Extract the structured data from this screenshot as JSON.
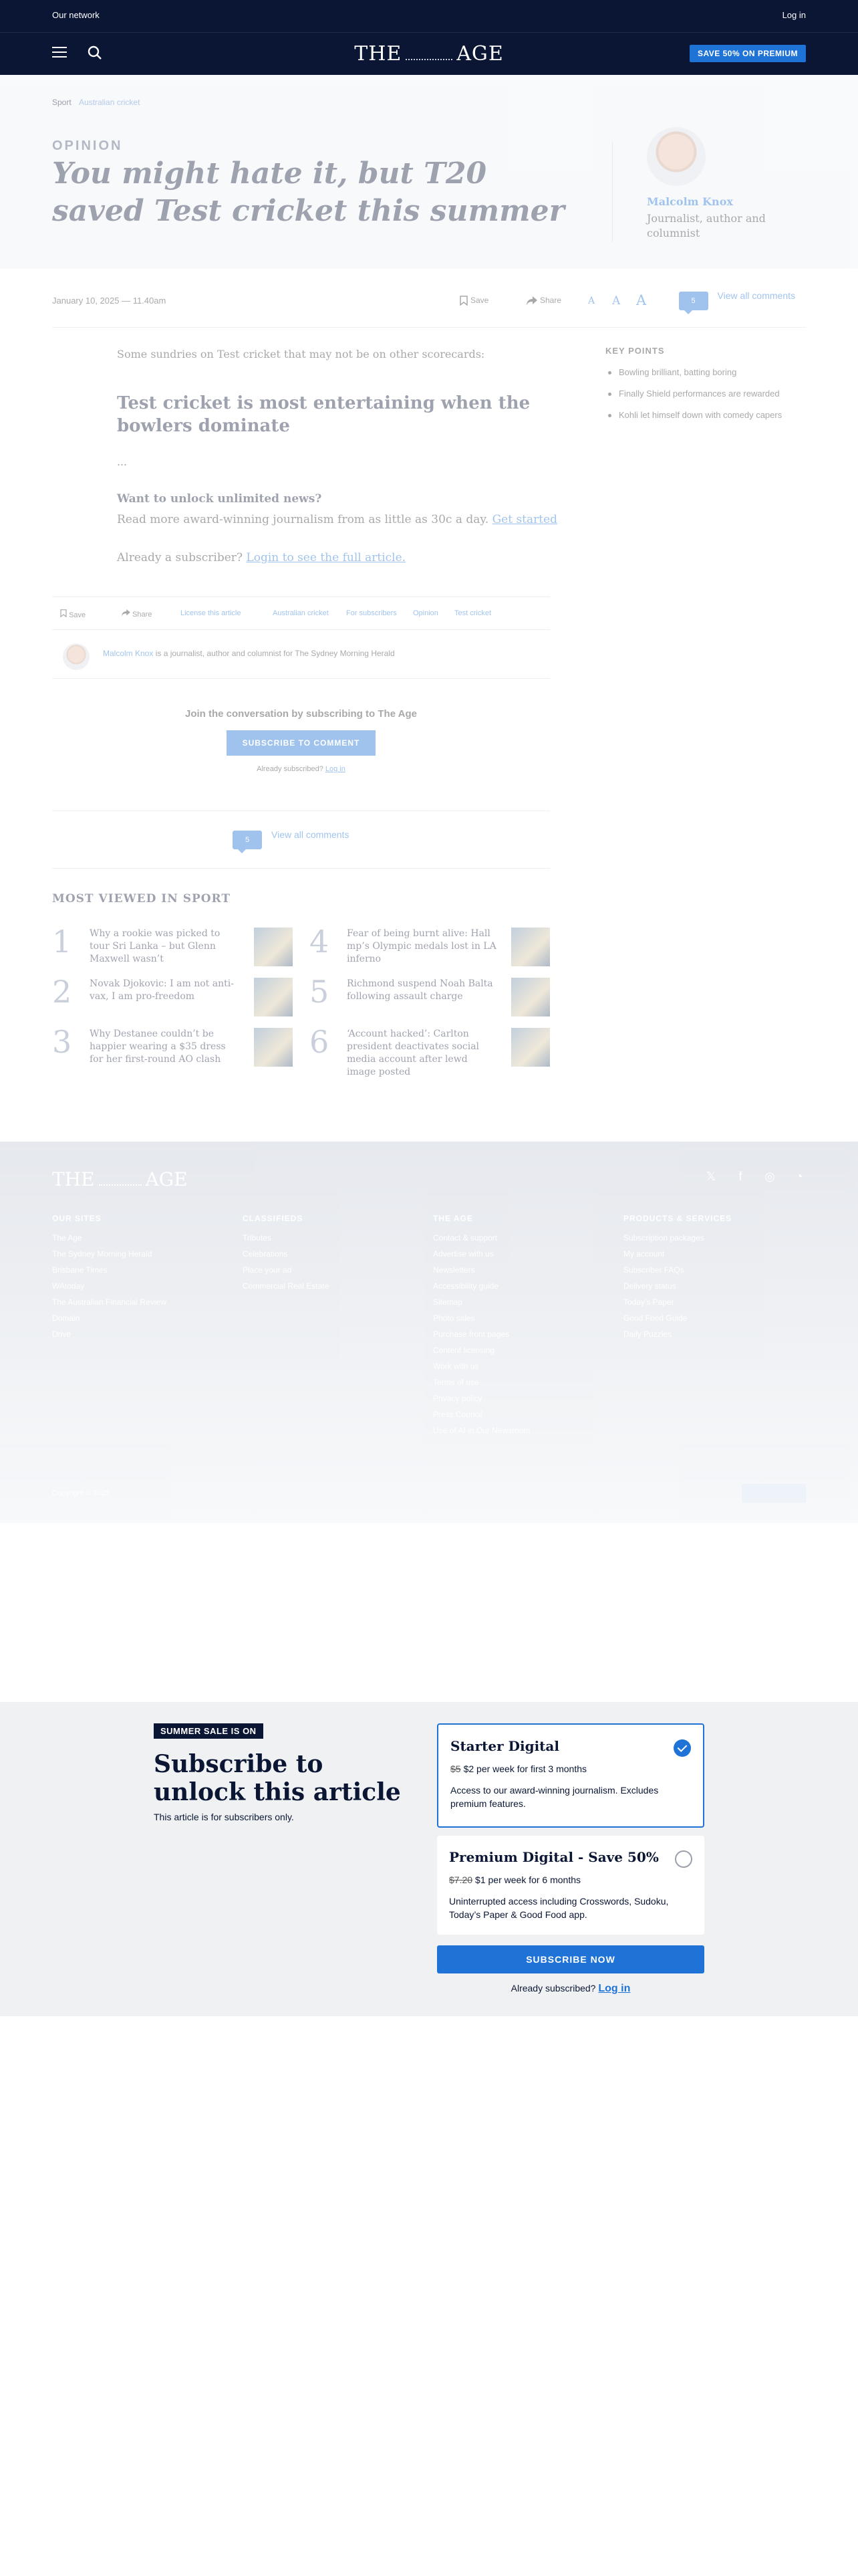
{
  "topbar": {
    "network": "Our network",
    "login": "Log in"
  },
  "header": {
    "logo_left": "THE",
    "logo_right": "AGE",
    "premium": "SAVE 50% ON PREMIUM"
  },
  "breadcrumb": {
    "section": "Sport",
    "subsection": "Australian cricket"
  },
  "article": {
    "kicker": "OPINION",
    "headline": "You might hate it, but T20 saved Test cricket this summer",
    "author_name": "Malcolm Knox",
    "author_title": "Journalist, author and columnist",
    "date": "January 10, 2025 — 11.40am",
    "save": "Save",
    "share": "Share",
    "font_a": "A",
    "comment_count": "5",
    "view_comments": "View all comments",
    "lead": "Some sundries on Test cricket that may not be on other scorecards:",
    "subhead": "Test cricket is most entertaining when the bowlers dominate",
    "ellipsis": "...",
    "unlock_q": "Want to unlock unlimited news?",
    "unlock_text": "Read more award-winning journalism from as little as 30c a day.",
    "get_started": "Get started",
    "already_text": "Already a subscriber?",
    "login_link": "Login to see the full article."
  },
  "key_points": {
    "title": "KEY POINTS",
    "items": [
      "Bowling brilliant, batting boring",
      "Finally Shield performances are rewarded",
      "Kohli let himself down with comedy capers"
    ]
  },
  "tagbar": {
    "save": "Save",
    "share": "Share",
    "license": "License this article",
    "tags": [
      "Australian cricket",
      "For subscribers",
      "Opinion",
      "Test cricket"
    ]
  },
  "bio": {
    "name": "Malcolm Knox",
    "text": "is a journalist, author and columnist for The Sydney Morning Herald"
  },
  "join": {
    "title": "Join the conversation by subscribing to The Age",
    "button": "SUBSCRIBE TO COMMENT",
    "already": "Already subscribed?",
    "login": "Log in"
  },
  "most_viewed": {
    "title": "MOST VIEWED IN SPORT",
    "items": [
      {
        "num": "1",
        "title": "Why a rookie was picked to tour Sri Lanka – but Glenn Maxwell wasn’t"
      },
      {
        "num": "2",
        "title": "Novak Djokovic: I am not anti-vax, I am pro-freedom"
      },
      {
        "num": "3",
        "title": "Why Destanee couldn’t be happier wearing a $35 dress for her first-round AO clash"
      },
      {
        "num": "4",
        "title": "Fear of being burnt alive: Hall mp’s Olympic medals lost in LA inferno"
      },
      {
        "num": "5",
        "title": "Richmond suspend Noah Balta following assault charge"
      },
      {
        "num": "6",
        "title": "‘Account hacked’: Carlton president deactivates social media account after lewd image posted"
      }
    ]
  },
  "footer": {
    "logo_left": "THE",
    "logo_right": "AGE",
    "social": [
      "x-icon",
      "facebook-icon",
      "instagram-icon",
      "rss-icon"
    ],
    "columns": [
      {
        "title": "OUR SITES",
        "links": [
          "The Age",
          "The Sydney Morning Herald",
          "Brisbane Times",
          "WAtoday",
          "The Australian Financial Review",
          "Domain",
          "Drive"
        ]
      },
      {
        "title": "CLASSIFIEDS",
        "links": [
          "Tributes",
          "Celebrations",
          "Place your ad",
          "Commercial Real Estate"
        ]
      },
      {
        "title": "THE AGE",
        "links": [
          "Contact & support",
          "Advertise with us",
          "Newsletters",
          "Accessibility guide",
          "Sitemap",
          "Photo sales",
          "Purchase front pages",
          "Content licensing",
          "Work with us",
          "Terms of use",
          "Privacy policy",
          "Press Council",
          "Use of AI in Our Newsroom"
        ]
      },
      {
        "title": "PRODUCTS & SERVICES",
        "links": [
          "Subscription packages",
          "My account",
          "Subscriber FAQs",
          "Delivery status",
          "Today's Paper",
          "Good Food Guide",
          "Daily Puzzles"
        ]
      }
    ],
    "copyright": "Copyright © 2025"
  },
  "subscribe_panel": {
    "badge": "SUMMER SALE IS ON",
    "title": "Subscribe to unlock this article",
    "subtitle": "This article is for subscribers only.",
    "plans": [
      {
        "name": "Starter Digital",
        "old_price": "$5",
        "price": "$2 per week for first 3 months",
        "desc": "Access to our award-winning journalism. Excludes premium features.",
        "selected": true
      },
      {
        "name": "Premium Digital - Save 50%",
        "old_price": "$7.20",
        "price": "$1 per week for 6 months",
        "desc": "Uninterrupted access including Crosswords, Sudoku, Today’s Paper & Good Food app.",
        "selected": false
      }
    ],
    "button": "SUBSCRIBE NOW",
    "already": "Already subscribed?",
    "login": "Log in"
  },
  "colors": {
    "navy": "#0a1633",
    "accent": "#1f72d6",
    "panel_bg": "#f0f1f3"
  }
}
